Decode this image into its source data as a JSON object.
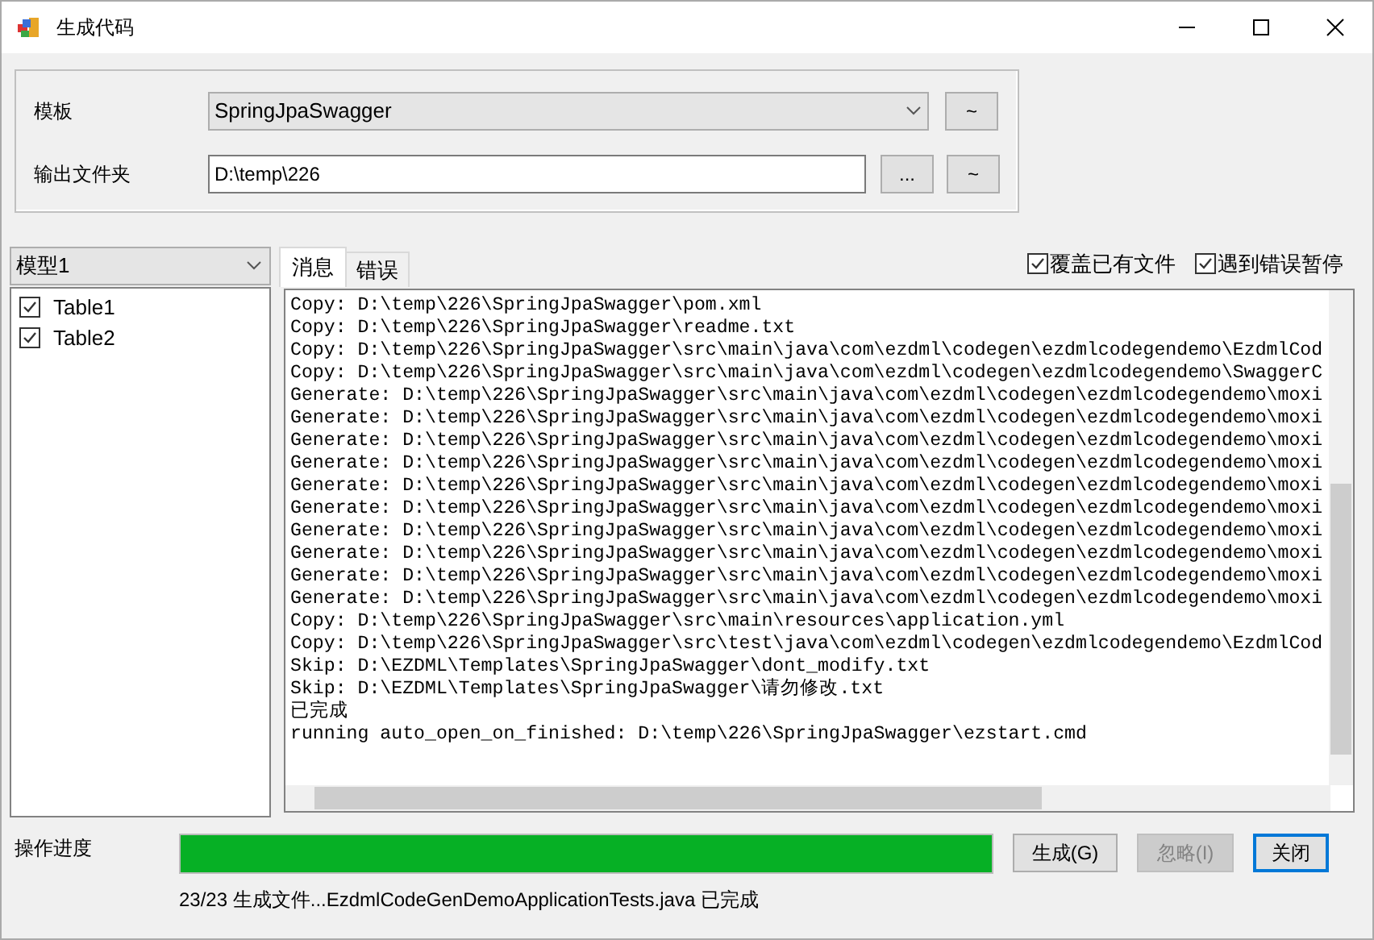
{
  "window": {
    "title": "生成代码"
  },
  "settings": {
    "template_label": "模板",
    "template_value": "SpringJpaSwagger",
    "template_button": "~",
    "output_label": "输出文件夹",
    "output_value": "D:\\temp\\226",
    "browse_button": "...",
    "output_button": "~"
  },
  "model": {
    "value": "模型1",
    "tables": [
      {
        "label": "Table1",
        "checked": true
      },
      {
        "label": "Table2",
        "checked": true
      }
    ]
  },
  "tabs": [
    {
      "label": "消息",
      "selected": true
    },
    {
      "label": "错误",
      "selected": false
    }
  ],
  "options": [
    {
      "label": "覆盖已有文件",
      "checked": true
    },
    {
      "label": "遇到错误暂停",
      "checked": true
    }
  ],
  "log": [
    "Copy: D:\\temp\\226\\SpringJpaSwagger\\pom.xml",
    "Copy: D:\\temp\\226\\SpringJpaSwagger\\readme.txt",
    "Copy: D:\\temp\\226\\SpringJpaSwagger\\src\\main\\java\\com\\ezdml\\codegen\\ezdmlcodegendemo\\EzdmlCod",
    "Copy: D:\\temp\\226\\SpringJpaSwagger\\src\\main\\java\\com\\ezdml\\codegen\\ezdmlcodegendemo\\SwaggerC",
    "Generate: D:\\temp\\226\\SpringJpaSwagger\\src\\main\\java\\com\\ezdml\\codegen\\ezdmlcodegendemo\\moxi",
    "Generate: D:\\temp\\226\\SpringJpaSwagger\\src\\main\\java\\com\\ezdml\\codegen\\ezdmlcodegendemo\\moxi",
    "Generate: D:\\temp\\226\\SpringJpaSwagger\\src\\main\\java\\com\\ezdml\\codegen\\ezdmlcodegendemo\\moxi",
    "Generate: D:\\temp\\226\\SpringJpaSwagger\\src\\main\\java\\com\\ezdml\\codegen\\ezdmlcodegendemo\\moxi",
    "Generate: D:\\temp\\226\\SpringJpaSwagger\\src\\main\\java\\com\\ezdml\\codegen\\ezdmlcodegendemo\\moxi",
    "Generate: D:\\temp\\226\\SpringJpaSwagger\\src\\main\\java\\com\\ezdml\\codegen\\ezdmlcodegendemo\\moxi",
    "Generate: D:\\temp\\226\\SpringJpaSwagger\\src\\main\\java\\com\\ezdml\\codegen\\ezdmlcodegendemo\\moxi",
    "Generate: D:\\temp\\226\\SpringJpaSwagger\\src\\main\\java\\com\\ezdml\\codegen\\ezdmlcodegendemo\\moxi",
    "Generate: D:\\temp\\226\\SpringJpaSwagger\\src\\main\\java\\com\\ezdml\\codegen\\ezdmlcodegendemo\\moxi",
    "Generate: D:\\temp\\226\\SpringJpaSwagger\\src\\main\\java\\com\\ezdml\\codegen\\ezdmlcodegendemo\\moxi",
    "Copy: D:\\temp\\226\\SpringJpaSwagger\\src\\main\\resources\\application.yml",
    "Copy: D:\\temp\\226\\SpringJpaSwagger\\src\\test\\java\\com\\ezdml\\codegen\\ezdmlcodegendemo\\EzdmlCod",
    "Skip: D:\\EZDML\\Templates\\SpringJpaSwagger\\dont_modify.txt",
    "Skip: D:\\EZDML\\Templates\\SpringJpaSwagger\\请勿修改.txt",
    "已完成",
    "running auto_open_on_finished: D:\\temp\\226\\SpringJpaSwagger\\ezstart.cmd"
  ],
  "progress": {
    "label": "操作进度",
    "level": 1,
    "status": "23/23 生成文件...EzdmlCodeGenDemoApplicationTests.java 已完成"
  },
  "buttons": [
    {
      "label": "生成(G)",
      "disabled": false,
      "default": false
    },
    {
      "label": "忽略(I)",
      "disabled": true,
      "default": false
    },
    {
      "label": "关闭",
      "disabled": false,
      "default": true
    }
  ]
}
